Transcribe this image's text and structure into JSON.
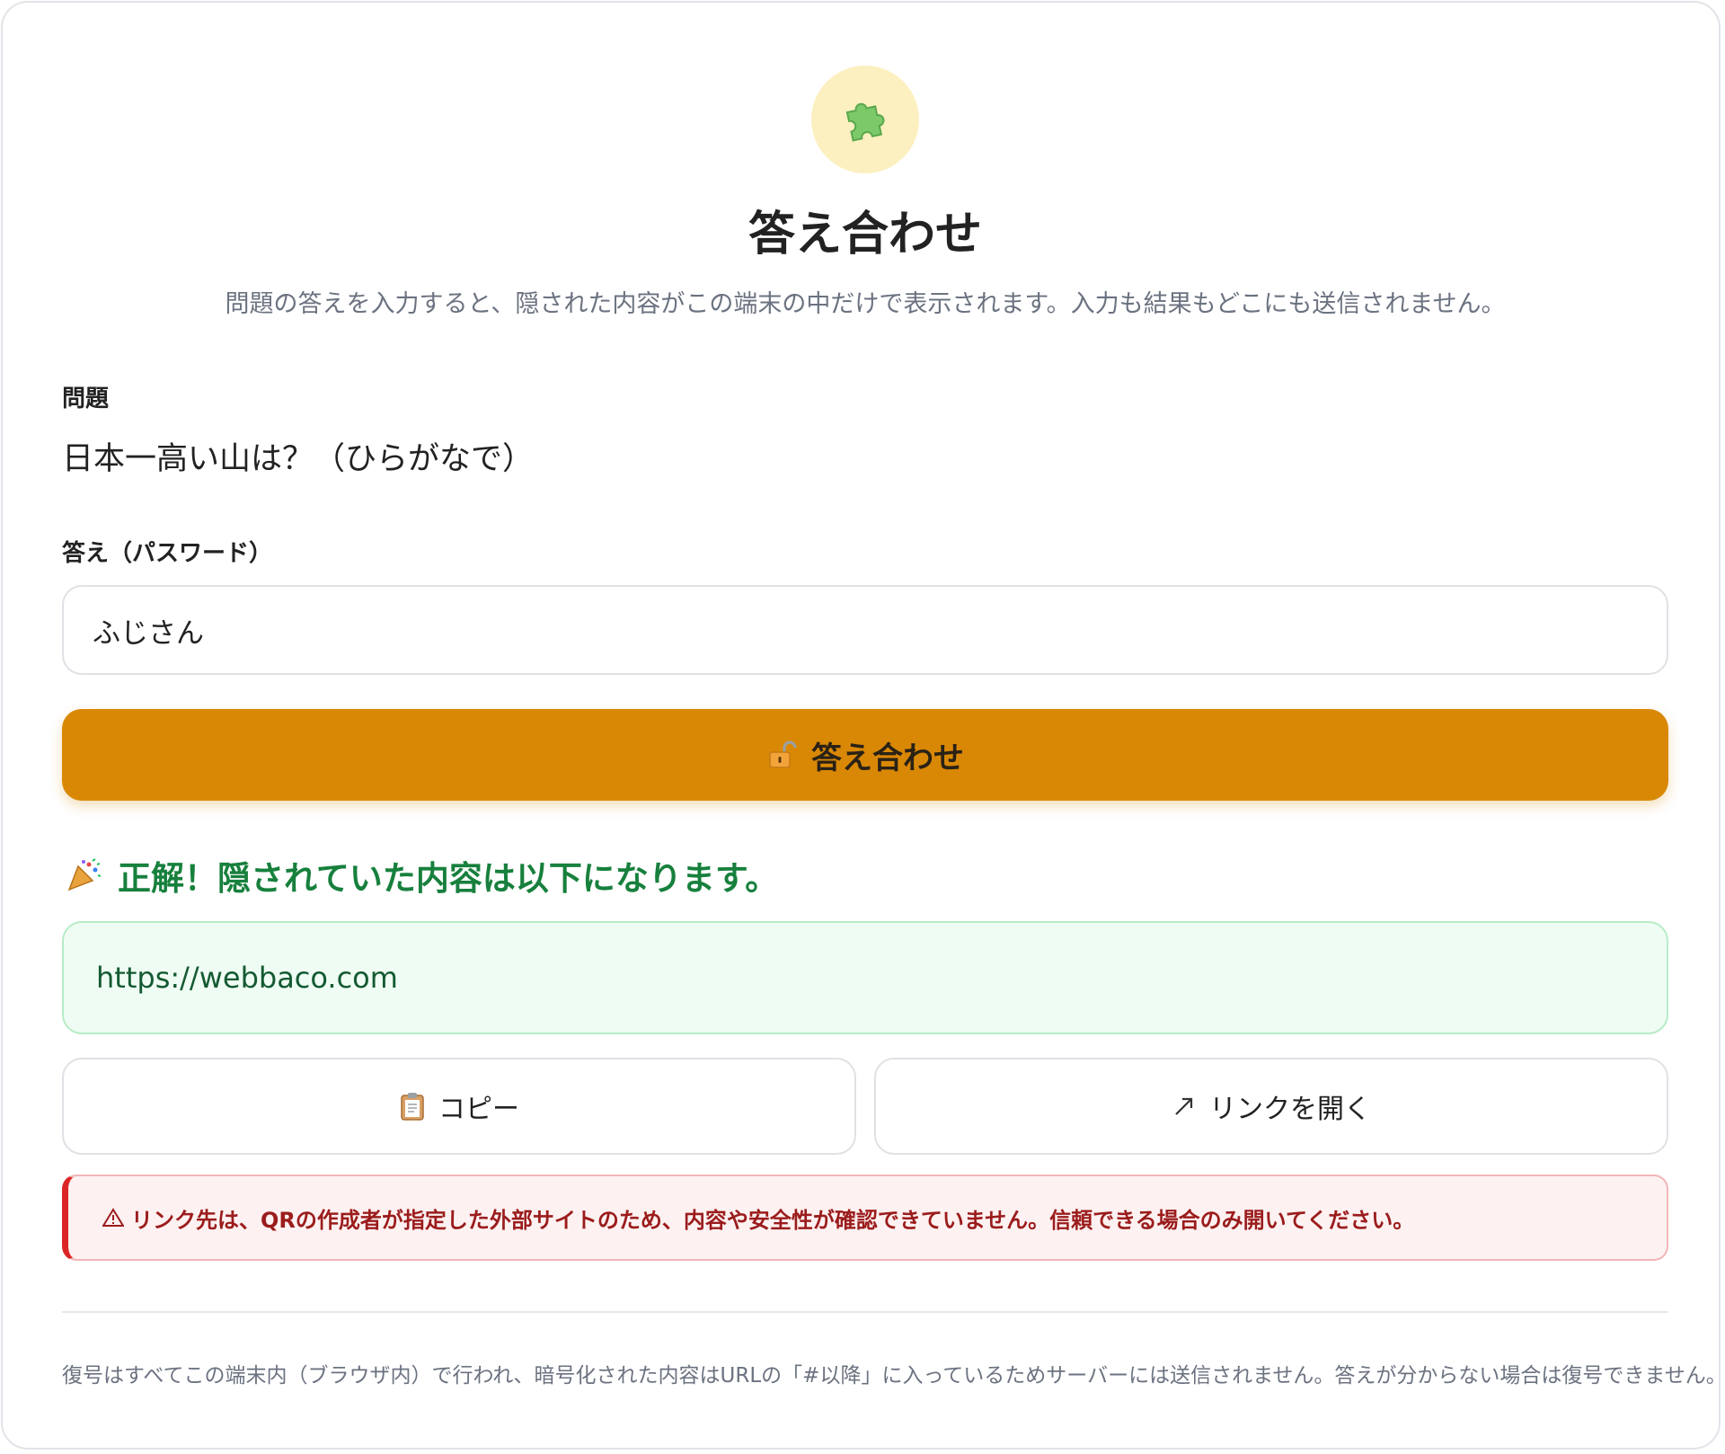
{
  "header": {
    "icon": "puzzle-piece-icon",
    "title": "答え合わせ",
    "subtitle": "問題の答えを入力すると、隠された内容がこの端末の中だけで表示されます。入力も結果もどこにも送信されません。"
  },
  "question": {
    "label": "問題",
    "text": "日本一高い山は？（ひらがなで）"
  },
  "answer": {
    "label": "答え（パスワード）",
    "value": "ふじさん"
  },
  "submit": {
    "icon": "unlocked-padlock-icon",
    "label": "答え合わせ"
  },
  "result": {
    "icon": "party-popper-icon",
    "message": "正解！隠されていた内容は以下になります。",
    "content": "https://webbaco.com"
  },
  "actions": {
    "copy_icon": "clipboard-icon",
    "copy_label": "コピー",
    "open_icon": "arrow-up-right-icon",
    "open_label": "リンクを開く"
  },
  "warning": {
    "icon": "warning-icon",
    "text": "リンク先は、QRの作成者が指定した外部サイトのため、内容や安全性が確認できていません。信頼できる場合のみ開いてください。"
  },
  "footer": {
    "note": "復号はすべてこの端末内（ブラウザ内）で行われ、暗号化された内容はURLの「#以降」に入っているためサーバーには送信されません。答えが分からない場合は復号できません。"
  },
  "colors": {
    "accent": "#d98806",
    "success": "#17803d",
    "danger": "#dc2626"
  }
}
